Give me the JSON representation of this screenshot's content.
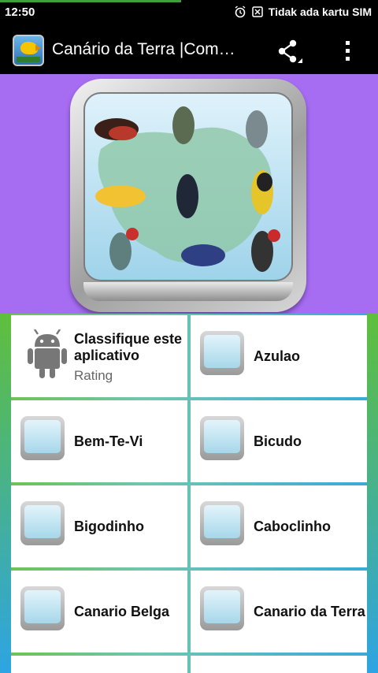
{
  "status": {
    "time": "12:50",
    "carrier": "Tidak ada kartu SIM",
    "icons": [
      "alarm-icon",
      "no-sim-icon"
    ]
  },
  "app_bar": {
    "title": "Canário da Terra |Com…",
    "icon": "app-logo-icon",
    "actions": [
      "share-icon",
      "overflow-menu-icon"
    ]
  },
  "rating_tile": {
    "title": "Classifique este aplicativo",
    "subtitle": "Rating",
    "icon": "android-icon"
  },
  "tiles": [
    {
      "label": "Azulao"
    },
    {
      "label": "Bem-Te-Vi"
    },
    {
      "label": "Bicudo"
    },
    {
      "label": "Bigodinho"
    },
    {
      "label": "Caboclinho"
    },
    {
      "label": "Canario Belga"
    },
    {
      "label": "Canario da Terra"
    }
  ],
  "colors": {
    "app_bar": "#000000",
    "hero_background": "#a66cf2",
    "grid_gradient_start": "#5fbf3b",
    "grid_gradient_end": "#2ea4e3",
    "tile_background": "#ffffff"
  }
}
